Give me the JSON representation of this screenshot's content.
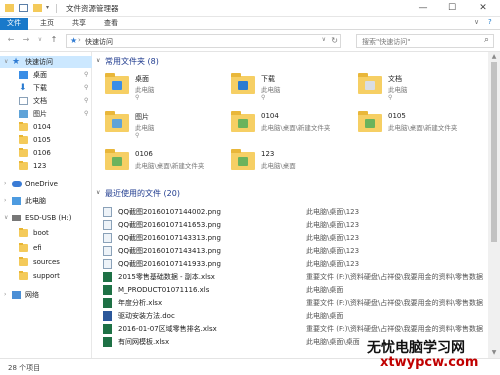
{
  "window": {
    "title": "文件资源管理器",
    "minimize": "—",
    "maximize": "☐",
    "close": "✕"
  },
  "ribbon": {
    "tabs": [
      "文件",
      "主页",
      "共享",
      "查看"
    ],
    "expand": "∨",
    "help": "?"
  },
  "nav": {
    "back": "←",
    "forward": "→",
    "recent": "∨",
    "up": "↑",
    "address_icon": "★",
    "address_sep": "›",
    "address": "快速访问",
    "address_dropdown": "∨",
    "refresh": "↻",
    "search_placeholder": "搜索\"快速访问\"",
    "search_icon": "⌕"
  },
  "sidebar": {
    "items": [
      {
        "label": "快速访问",
        "icon": "star-icon",
        "pinned": false
      },
      {
        "label": "桌面",
        "icon": "desktop-icon",
        "pinned": true
      },
      {
        "label": "下载",
        "icon": "download-icon",
        "pinned": true
      },
      {
        "label": "文档",
        "icon": "document-icon",
        "pinned": true
      },
      {
        "label": "图片",
        "icon": "pictures-icon",
        "pinned": true
      },
      {
        "label": "0104",
        "icon": "folder-icon",
        "pinned": false
      },
      {
        "label": "0105",
        "icon": "folder-icon",
        "pinned": false
      },
      {
        "label": "0106",
        "icon": "folder-icon",
        "pinned": false
      },
      {
        "label": "123",
        "icon": "folder-icon",
        "pinned": false
      },
      {
        "label": "OneDrive",
        "icon": "cloud-icon",
        "pinned": false
      },
      {
        "label": "此电脑",
        "icon": "computer-icon",
        "pinned": false
      },
      {
        "label": "ESD-USB (H:)",
        "icon": "usb-drive-icon",
        "pinned": false
      },
      {
        "label": "boot",
        "icon": "folder-icon",
        "pinned": false
      },
      {
        "label": "efi",
        "icon": "folder-icon",
        "pinned": false
      },
      {
        "label": "sources",
        "icon": "folder-icon",
        "pinned": false
      },
      {
        "label": "support",
        "icon": "folder-icon",
        "pinned": false
      },
      {
        "label": "网络",
        "icon": "network-icon",
        "pinned": false
      }
    ],
    "pin_glyph": "⚲",
    "chevron": "›",
    "expanded_chevron": "∨"
  },
  "frequent": {
    "title": "常用文件夹 (8)",
    "chevron": "∨",
    "folders": [
      {
        "name": "桌面",
        "location": "此电脑",
        "pinned": true,
        "badge_color": "#3a8ee6"
      },
      {
        "name": "下载",
        "location": "此电脑",
        "pinned": true,
        "badge_color": "#2a7bd0"
      },
      {
        "name": "文档",
        "location": "此电脑",
        "pinned": true,
        "badge_color": "#d9dde3"
      },
      {
        "name": "图片",
        "location": "此电脑",
        "pinned": true,
        "badge_color": "#5fa3d8"
      },
      {
        "name": "0104",
        "location": "此电脑\\桌面\\新建文件夹",
        "pinned": false,
        "badge_color": "#6bb35c"
      },
      {
        "name": "0105",
        "location": "此电脑\\桌面\\新建文件夹",
        "pinned": false,
        "badge_color": "#6bb35c"
      },
      {
        "name": "0106",
        "location": "此电脑\\桌面\\新建文件夹",
        "pinned": false,
        "badge_color": "#6bb35c"
      },
      {
        "name": "123",
        "location": "此电脑\\桌面",
        "pinned": false,
        "badge_color": "#6bb35c"
      }
    ]
  },
  "recent": {
    "title": "最近使用的文件 (20)",
    "chevron": "∨",
    "files": [
      {
        "name": "QQ截图20160107144002.png",
        "location": "此电脑\\桌面\\123",
        "type": "png"
      },
      {
        "name": "QQ截图20160107141653.png",
        "location": "此电脑\\桌面\\123",
        "type": "png"
      },
      {
        "name": "QQ截图20160107143313.png",
        "location": "此电脑\\桌面\\123",
        "type": "png"
      },
      {
        "name": "QQ截图20160107143413.png",
        "location": "此电脑\\桌面\\123",
        "type": "png"
      },
      {
        "name": "QQ截图20160107141933.png",
        "location": "此电脑\\桌面\\123",
        "type": "png"
      },
      {
        "name": "2015零售基础数据 - 副本.xlsx",
        "location": "重要文件 (F:)\\资料硬盘\\占祥俊\\我要用金的资料\\零售数据",
        "type": "xls"
      },
      {
        "name": "M_PRODUCT01071116.xls",
        "location": "此电脑\\桌面",
        "type": "xls"
      },
      {
        "name": "年度分析.xlsx",
        "location": "重要文件 (F:)\\资料硬盘\\占祥俊\\我要用金的资料\\零售数据",
        "type": "xls"
      },
      {
        "name": "驱动安装方法.doc",
        "location": "此电脑\\桌面",
        "type": "doc"
      },
      {
        "name": "2016-01-07区域零售排名.xlsx",
        "location": "重要文件 (F:)\\资料硬盘\\占祥俊\\我要用金的资料\\零售数据",
        "type": "xls"
      },
      {
        "name": "有间网模板.xlsx",
        "location": "此电脑\\桌面\\桌面",
        "type": "xls"
      }
    ]
  },
  "scroll": {
    "up": "▲",
    "down": "▼"
  },
  "status": {
    "count": "28 个项目"
  },
  "watermark": {
    "title": "无忧电脑学习网",
    "url": "xtwypcw.com"
  },
  "colors": {
    "accent": "#1979ca",
    "folder": "#f6cf64",
    "section_title": "#1f3b8f",
    "selected": "#cce8ff"
  }
}
